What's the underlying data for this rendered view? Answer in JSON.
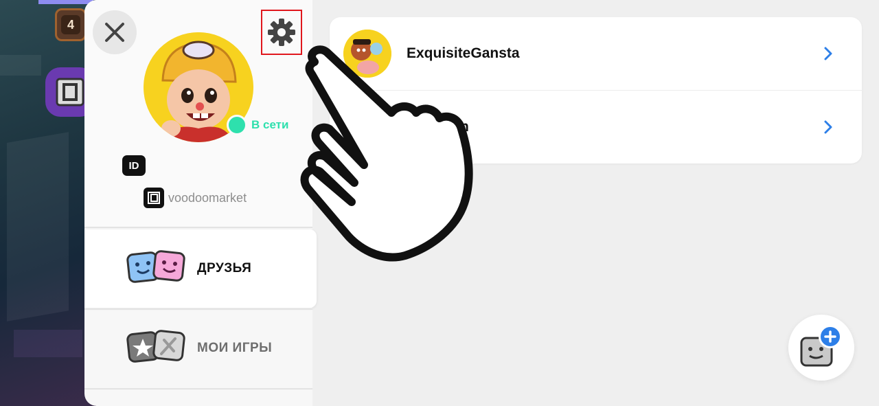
{
  "game_hud": {
    "level_value": "4"
  },
  "profile": {
    "status_text": "В сети",
    "id_label": "ID",
    "brand_name": "voodoomarket"
  },
  "menu": {
    "items": [
      {
        "label": "ДРУЗЬЯ",
        "active": true
      },
      {
        "label": "МОИ ИГРЫ",
        "active": false
      }
    ]
  },
  "friends": {
    "rows": [
      {
        "name": "ExquisiteGansta"
      },
      {
        "name": "n"
      }
    ]
  },
  "icons": {
    "close": "close-icon",
    "settings": "gear-icon",
    "chevron": "chevron-right-icon",
    "add_friend": "add-friend-icon",
    "plus": "plus-icon",
    "hand": "hand-pointer-icon"
  },
  "colors": {
    "online": "#2ee0ad",
    "accent_blue": "#2d7fe8",
    "highlight_red": "#e0161c",
    "avatar_yellow": "#f7d21f"
  }
}
